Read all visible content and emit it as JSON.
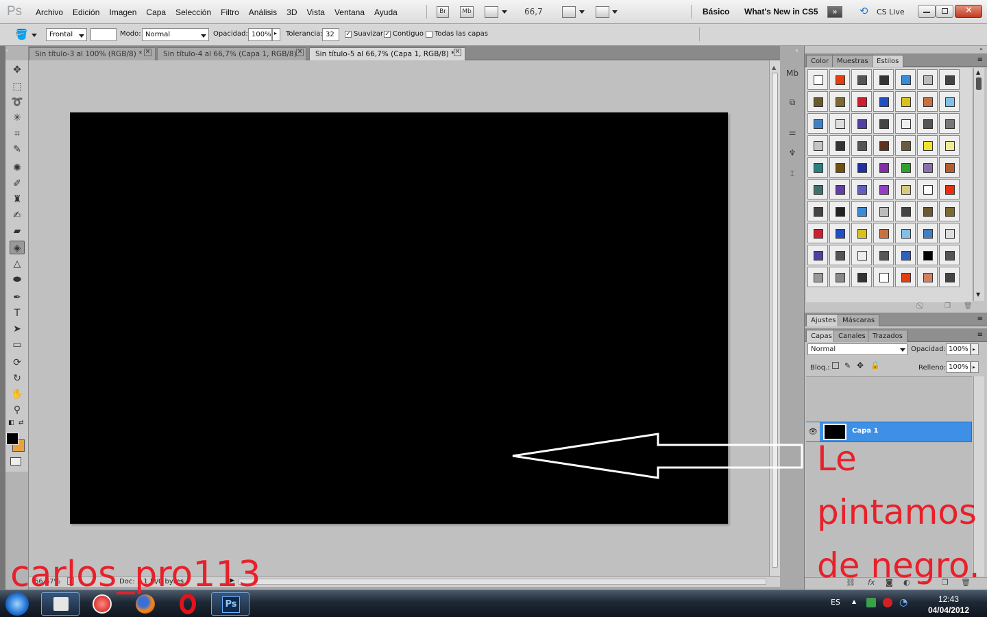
{
  "app": {
    "logo": "Ps"
  },
  "menubar": {
    "items": [
      "Archivo",
      "Edición",
      "Imagen",
      "Capa",
      "Selección",
      "Filtro",
      "Análisis",
      "3D",
      "Vista",
      "Ventana",
      "Ayuda"
    ],
    "bridge_btn": "Br",
    "minibridge_btn": "Mb",
    "zoom": "66,7",
    "workspace_basic": "Básico",
    "workspace_new": "What's New in CS5",
    "cslive": "CS Live"
  },
  "options": {
    "fill_source": "Frontal",
    "mode_label": "Modo:",
    "mode_value": "Normal",
    "opacity_label": "Opacidad:",
    "opacity_value": "100%",
    "tolerance_label": "Tolerancia:",
    "tolerance_value": "32",
    "antialias_label": "Suavizar",
    "contiguous_label": "Contiguo",
    "all_layers_label": "Todas las capas"
  },
  "documents": {
    "tabs": [
      {
        "title": "Sin título-3 al 100% (RGB/8) *"
      },
      {
        "title": "Sin título-4 al 66,7% (Capa 1, RGB/8)"
      },
      {
        "title": "Sin título-5 al 66,7% (Capa 1, RGB/8) *"
      }
    ]
  },
  "status": {
    "zoom": "66,67%",
    "doc": "Doc: 3,1 M/0 bytes"
  },
  "styles_panel": {
    "tabs": [
      "Color",
      "Muestras",
      "Estilos"
    ],
    "swatch_colors": [
      "#ffffff",
      "#e04010",
      "#555555",
      "#333333",
      "#3a8ad8",
      "#bbbbbb",
      "#444444",
      "#6b5a30",
      "#7a6a30",
      "#cc2030",
      "#2050c0",
      "#d8c020",
      "#c87040",
      "#80c0e8",
      "#4080c0",
      "#dddddd",
      "#5040a0",
      "#444444",
      "#eeeeee",
      "#555555",
      "#777777",
      "#c4c4c4",
      "#333333",
      "#555555",
      "#603020",
      "#6b5a40",
      "#f0e030",
      "#ecec90",
      "#2a8080",
      "#705010",
      "#2030a0",
      "#8030a0",
      "#30a030",
      "#8870a8",
      "#b06030",
      "#407070",
      "#6040a0",
      "#6060c0",
      "#9040c0",
      "#d8c880",
      "#ffffff",
      "#e83010",
      "#444444",
      "#222222",
      "#3a8ad8",
      "#bbbbbb",
      "#444444",
      "#6b5a30",
      "#7a6a30",
      "#cc2030",
      "#2050c0",
      "#d8c020",
      "#c87040",
      "#80c0e8",
      "#4080c0",
      "#dddddd",
      "#5040a0",
      "#555555",
      "#eeeeee",
      "#555555",
      "#3060c0",
      "#000000",
      "#555555",
      "#999999",
      "#888888",
      "#333333",
      "#ffffff",
      "#e04010",
      "#d08060",
      "#444444"
    ]
  },
  "adjust_panel": {
    "tabs": [
      "Ajustes",
      "Máscaras"
    ]
  },
  "layers_panel": {
    "tabs": [
      "Capas",
      "Canales",
      "Trazados"
    ],
    "blend_mode": "Normal",
    "opacity_label": "Opacidad:",
    "opacity_value": "100%",
    "lock_label": "Bloq.:",
    "fill_label": "Relleno:",
    "fill_value": "100%",
    "layer_name": "Capa 1"
  },
  "taskbar": {
    "language": "ES",
    "time": "12:43",
    "date": "04/04/2012"
  },
  "overlay": {
    "annotation_line1": "Le",
    "annotation_line2": "pintamos",
    "annotation_line3": "de negro.",
    "watermark": "carlos_pro113",
    "color": "#e8202a"
  }
}
